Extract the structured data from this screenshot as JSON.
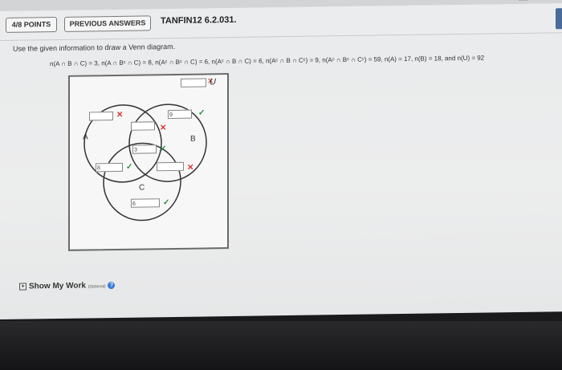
{
  "header": {
    "points": "4/8 POINTS",
    "previous_answers": "PREVIOUS ANSWERS",
    "question_id": "TANFIN12 6.2.031."
  },
  "instructions": "Use the given information to draw a Venn diagram.",
  "givens": "n(A ∩ B ∩ C) = 3, n(A ∩ Bᶜ ∩ C) = 8, n(Aᶜ ∩ Bᶜ ∩ C) = 6, n(Aᶜ ∩ B ∩ C) = 6, n(Aᶜ ∩ B ∩ Cᶜ) = 9, n(Aᶜ ∩ Bᶜ ∩ Cᶜ) = 59, n(A) = 17, n(B) = 18, and n(U) = 92",
  "venn": {
    "universe_label": "U",
    "labels": {
      "a": "A",
      "b": "B",
      "c": "C"
    },
    "inputs": {
      "u": "",
      "a_only": "",
      "a_b": "",
      "b_only": "9",
      "abc": "3",
      "a_c": "8",
      "b_c": "",
      "c_only": "6"
    },
    "status": {
      "u": "wrong",
      "a_only": "wrong",
      "a_b": "wrong",
      "b_only": "correct",
      "abc": "correct",
      "a_c": "correct",
      "b_c": "wrong",
      "c_only": "correct"
    }
  },
  "show_my_work": {
    "label": "Show My Work",
    "optional": "(Optional)",
    "help": "?"
  },
  "colors": {
    "correct": "#1b8a3a",
    "wrong": "#d33333",
    "help": "#3a7bd5"
  }
}
